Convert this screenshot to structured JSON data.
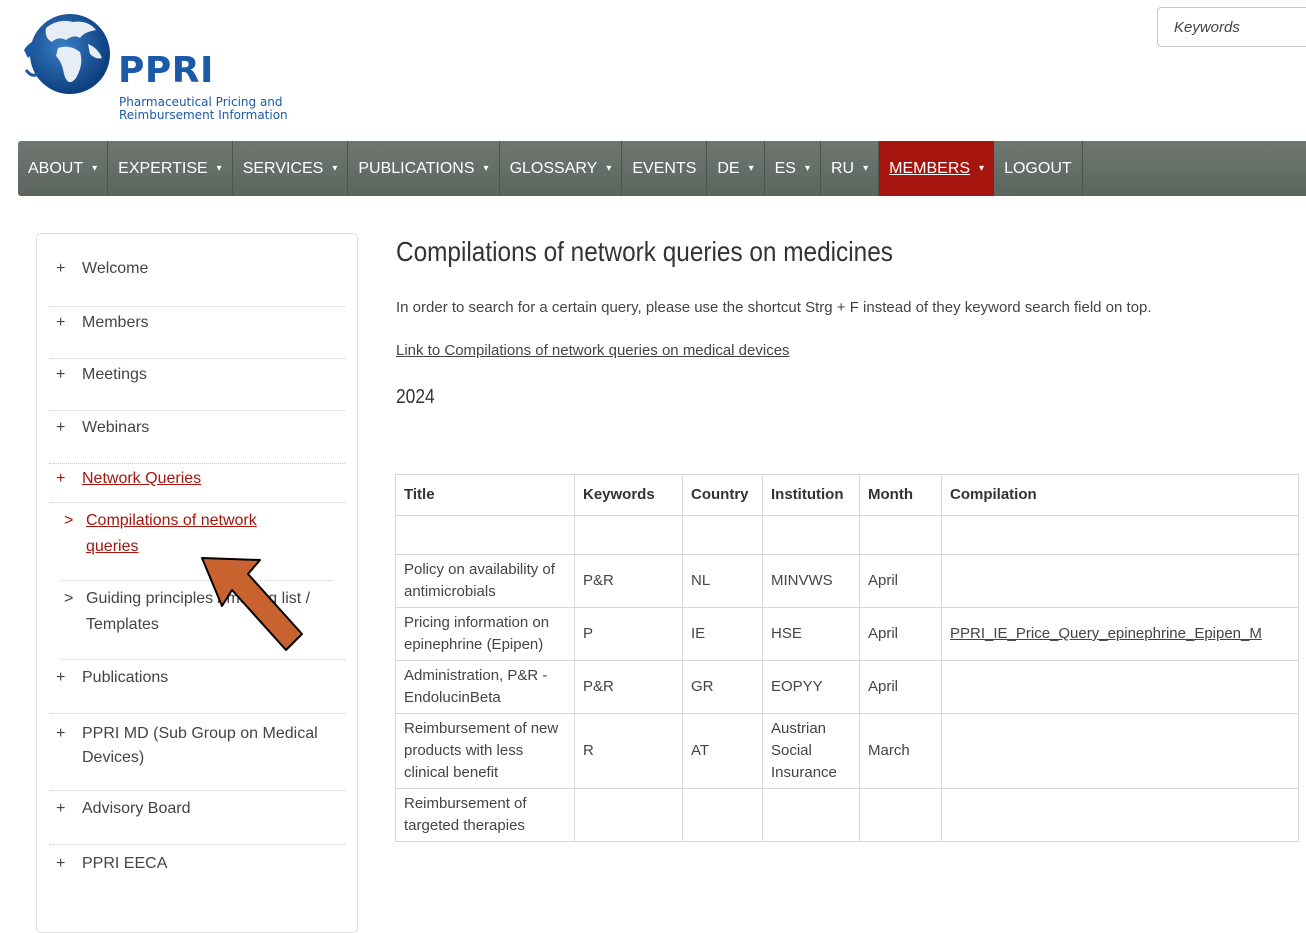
{
  "header": {
    "logo_title": "PPRI",
    "logo_subtitle_line1": "Pharmaceutical Pricing and",
    "logo_subtitle_line2": "Reimbursement Information",
    "search_placeholder": "Keywords"
  },
  "nav": {
    "items": [
      {
        "label": "ABOUT",
        "dropdown": true
      },
      {
        "label": "EXPERTISE",
        "dropdown": true
      },
      {
        "label": "SERVICES",
        "dropdown": true
      },
      {
        "label": "PUBLICATIONS",
        "dropdown": true
      },
      {
        "label": "GLOSSARY",
        "dropdown": true
      },
      {
        "label": "EVENTS",
        "dropdown": false
      },
      {
        "label": "DE",
        "dropdown": true
      },
      {
        "label": "ES",
        "dropdown": true
      },
      {
        "label": "RU",
        "dropdown": true
      },
      {
        "label": "MEMBERS",
        "dropdown": true,
        "active": true
      },
      {
        "label": "LOGOUT",
        "dropdown": false
      }
    ],
    "caret_glyph": "▾",
    "active_color": "#a6150d",
    "bar_color": "#636b65"
  },
  "sidebar": {
    "plus": "+",
    "chevron": ">",
    "items": [
      {
        "label": "Welcome"
      },
      {
        "label": "Members"
      },
      {
        "label": "Meetings"
      },
      {
        "label": "Webinars"
      },
      {
        "label": "Network Queries"
      },
      {
        "label": "Publications"
      },
      {
        "label": "PPRI MD (Sub Group on Medical Devices)"
      },
      {
        "label": "Advisory Board"
      },
      {
        "label": "PPRI EECA"
      }
    ],
    "sub_items": [
      {
        "label": "Compilations of network queries"
      },
      {
        "label": "Guiding principles / mailing list / Templates"
      }
    ]
  },
  "main": {
    "title": "Compilations of network queries on medicines",
    "intro": "In order to search for a certain query, please use the shortcut Strg + F instead of they keyword search field on top.",
    "link": "Link to Compilations of network queries on medical devices",
    "year": "2024",
    "table": {
      "headers": [
        "Title",
        "Keywords",
        "Country",
        "Institution",
        "Month",
        "Compilation"
      ],
      "rows": [
        {
          "title": "",
          "keywords": "",
          "country": "",
          "institution": "",
          "month": "",
          "compilation": ""
        },
        {
          "title": "Policy on availability of antimicrobials",
          "keywords": "P&R",
          "country": "NL",
          "institution": "MINVWS",
          "month": "April",
          "compilation": ""
        },
        {
          "title": "Pricing information on epinephrine (Epipen)",
          "keywords": "P",
          "country": "IE",
          "institution": "HSE",
          "month": "April",
          "compilation": "PPRI_IE_Price_Query_epinephrine_Epipen_M"
        },
        {
          "title": "Administration, P&R - EndolucinBeta",
          "keywords": "P&R",
          "country": "GR",
          "institution": "EOPYY",
          "month": "April",
          "compilation": ""
        },
        {
          "title": "Reimbursement of new products with less clinical benefit",
          "keywords": "R",
          "country": "AT",
          "institution": "Austrian Social Insurance",
          "month": "March",
          "compilation": ""
        },
        {
          "title": "Reimbursement of targeted therapies",
          "keywords": "",
          "country": "",
          "institution": "",
          "month": "",
          "compilation": ""
        }
      ]
    }
  },
  "overlay": {
    "arrow_color": "#c8622e"
  }
}
